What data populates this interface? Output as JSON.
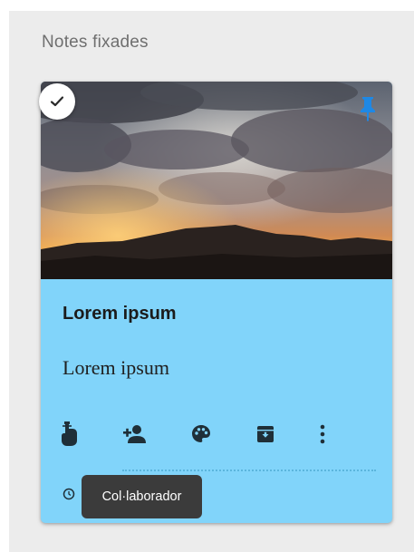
{
  "section": {
    "title": "Notes fixades"
  },
  "note": {
    "title": "Lorem ipsum",
    "body": "Lorem ipsum",
    "color": "#81d4fa",
    "image": "sunset-clouds-over-mountains",
    "pinned": true,
    "selected": true
  },
  "toolbar": {
    "icons": [
      "reminder-icon",
      "add-collaborator-icon",
      "palette-icon",
      "archive-icon",
      "more-vert-icon"
    ]
  },
  "tooltip": {
    "text": "Col·laborador"
  },
  "colors": {
    "accent_pin": "#1e88e5",
    "panel": "#ececec",
    "tooltip": "#3b3b3b"
  }
}
